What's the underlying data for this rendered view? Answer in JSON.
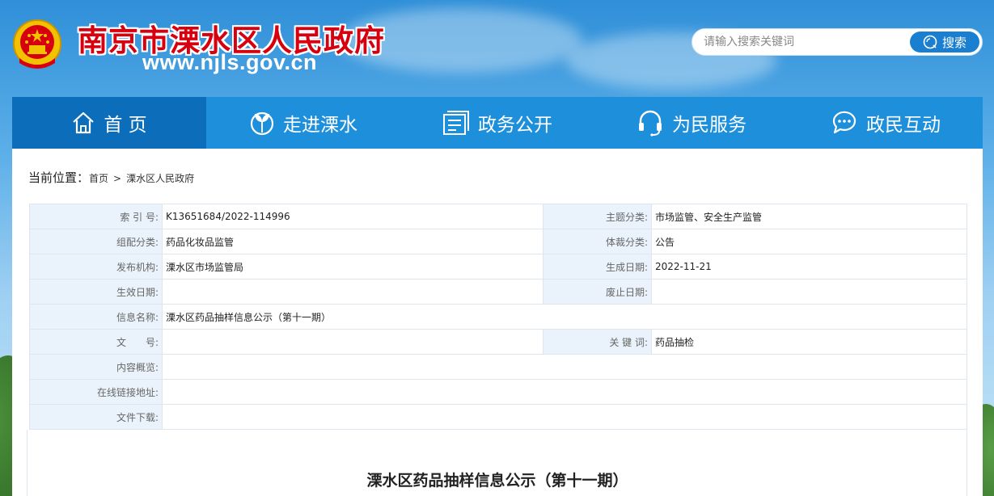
{
  "header": {
    "site_title": "南京市溧水区人民政府",
    "site_url": "www.njls.gov.cn",
    "emblem_icon": "national-emblem-icon",
    "search": {
      "placeholder": "请输入搜索关键词",
      "button_label": "搜索",
      "icon": "search-icon"
    }
  },
  "nav": {
    "items": [
      {
        "label": "首 页",
        "icon": "home-icon",
        "active": true
      },
      {
        "label": "走进溧水",
        "icon": "leaf-icon",
        "active": false
      },
      {
        "label": "政务公开",
        "icon": "document-icon",
        "active": false
      },
      {
        "label": "为民服务",
        "icon": "headset-icon",
        "active": false
      },
      {
        "label": "政民互动",
        "icon": "chat-icon",
        "active": false
      }
    ]
  },
  "breadcrumb": {
    "label": "当前位置：",
    "items": [
      "首页",
      "溧水区人民政府"
    ],
    "separator": ">"
  },
  "meta": {
    "index_no_label": "索 引 号:",
    "index_no": "K13651684/2022-114996",
    "topic_label": "主题分类:",
    "topic": "市场监管、安全生产监管",
    "org_category_label": "组配分类:",
    "org_category": "药品化妆品监管",
    "genre_label": "体裁分类:",
    "genre": "公告",
    "publisher_label": "发布机构:",
    "publisher": "溧水区市场监管局",
    "created_label": "生成日期:",
    "created": "2022-11-21",
    "effective_label": "生效日期:",
    "effective": "",
    "expiry_label": "废止日期:",
    "expiry": "",
    "info_name_label": "信息名称:",
    "info_name": "溧水区药品抽样信息公示（第十一期）",
    "doc_no_label": "文　　号:",
    "doc_no": "",
    "keywords_label": "关 键 词:",
    "keywords": "药品抽检",
    "summary_label": "内容概览:",
    "summary": "",
    "online_link_label": "在线链接地址:",
    "online_link": "",
    "download_label": "文件下载:",
    "download": ""
  },
  "article": {
    "title": "溧水区药品抽样信息公示（第十一期）"
  },
  "colors": {
    "title_red": "#d7000f",
    "nav_blue": "#1e8fdb",
    "nav_active": "#0c6dbb",
    "label_bg": "#eaf3fb"
  }
}
